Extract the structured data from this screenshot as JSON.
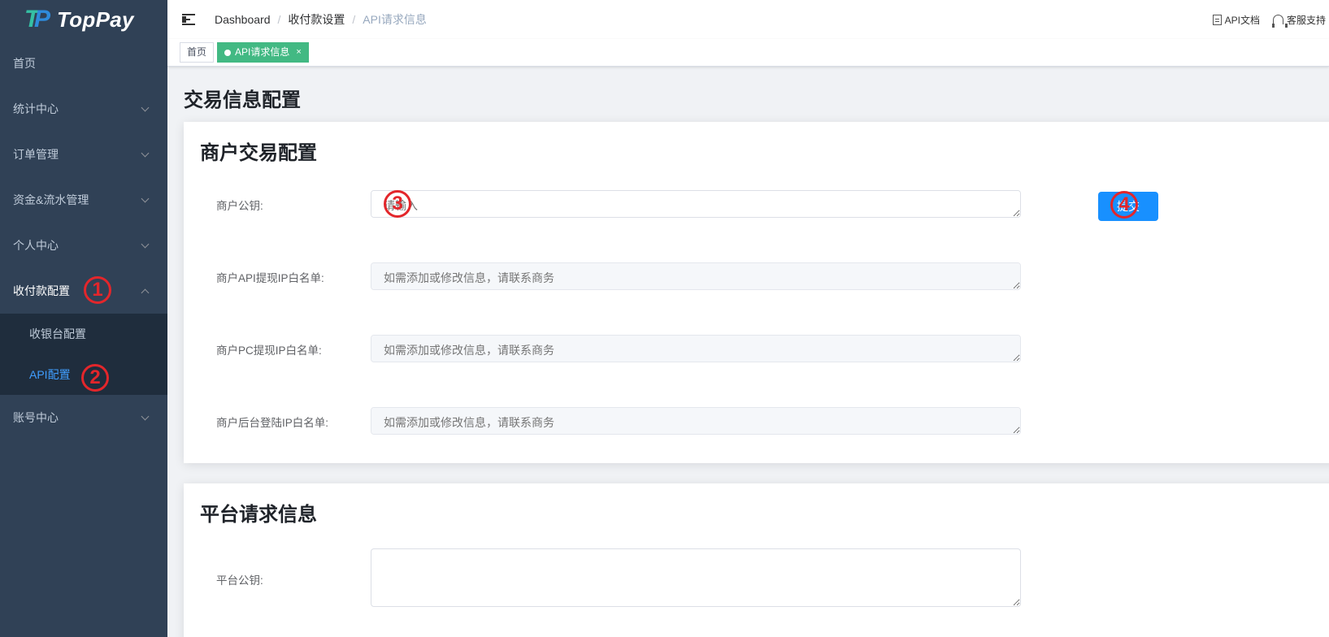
{
  "logo": {
    "mark": "TP",
    "text": "TopPay"
  },
  "sidebar": {
    "items": [
      {
        "label": "首页"
      },
      {
        "label": "统计中心"
      },
      {
        "label": "订单管理"
      },
      {
        "label": "资金&流水管理"
      },
      {
        "label": "个人中心"
      },
      {
        "label": "收付款配置"
      },
      {
        "label": "账号中心"
      }
    ],
    "submenu": [
      {
        "label": "收银台配置"
      },
      {
        "label": "API配置"
      }
    ]
  },
  "annotations": {
    "a1": "1",
    "a2": "2",
    "a3": "3",
    "a4": "4"
  },
  "header": {
    "breadcrumb": [
      "Dashboard",
      "收付款设置",
      "API请求信息"
    ],
    "separator": "/",
    "api_docs": "API文档",
    "support": "客服支持"
  },
  "tags": {
    "home": "首页",
    "current": "API请求信息",
    "close": "×"
  },
  "page": {
    "title": "交易信息配置",
    "merchant_card": {
      "title": "商户交易配置",
      "fields": [
        {
          "label": "商户公钥:",
          "placeholder": "请输入"
        },
        {
          "label": "商户API提现IP白名单:",
          "placeholder": "如需添加或修改信息，请联系商务"
        },
        {
          "label": "商户PC提现IP白名单:",
          "placeholder": "如需添加或修改信息，请联系商务"
        },
        {
          "label": "商户后台登陆IP白名单:",
          "placeholder": "如需添加或修改信息，请联系商务"
        }
      ],
      "submit": "提交"
    },
    "platform_card": {
      "title": "平台请求信息",
      "fields": [
        {
          "label": "平台公钥:"
        }
      ]
    }
  },
  "colors": {
    "sidebar_bg": "#304156",
    "submenu_bg": "#1f2d3d",
    "accent": "#409eff",
    "tag_active": "#42b983",
    "button": "#1890ff",
    "annotation": "#e3262b"
  }
}
